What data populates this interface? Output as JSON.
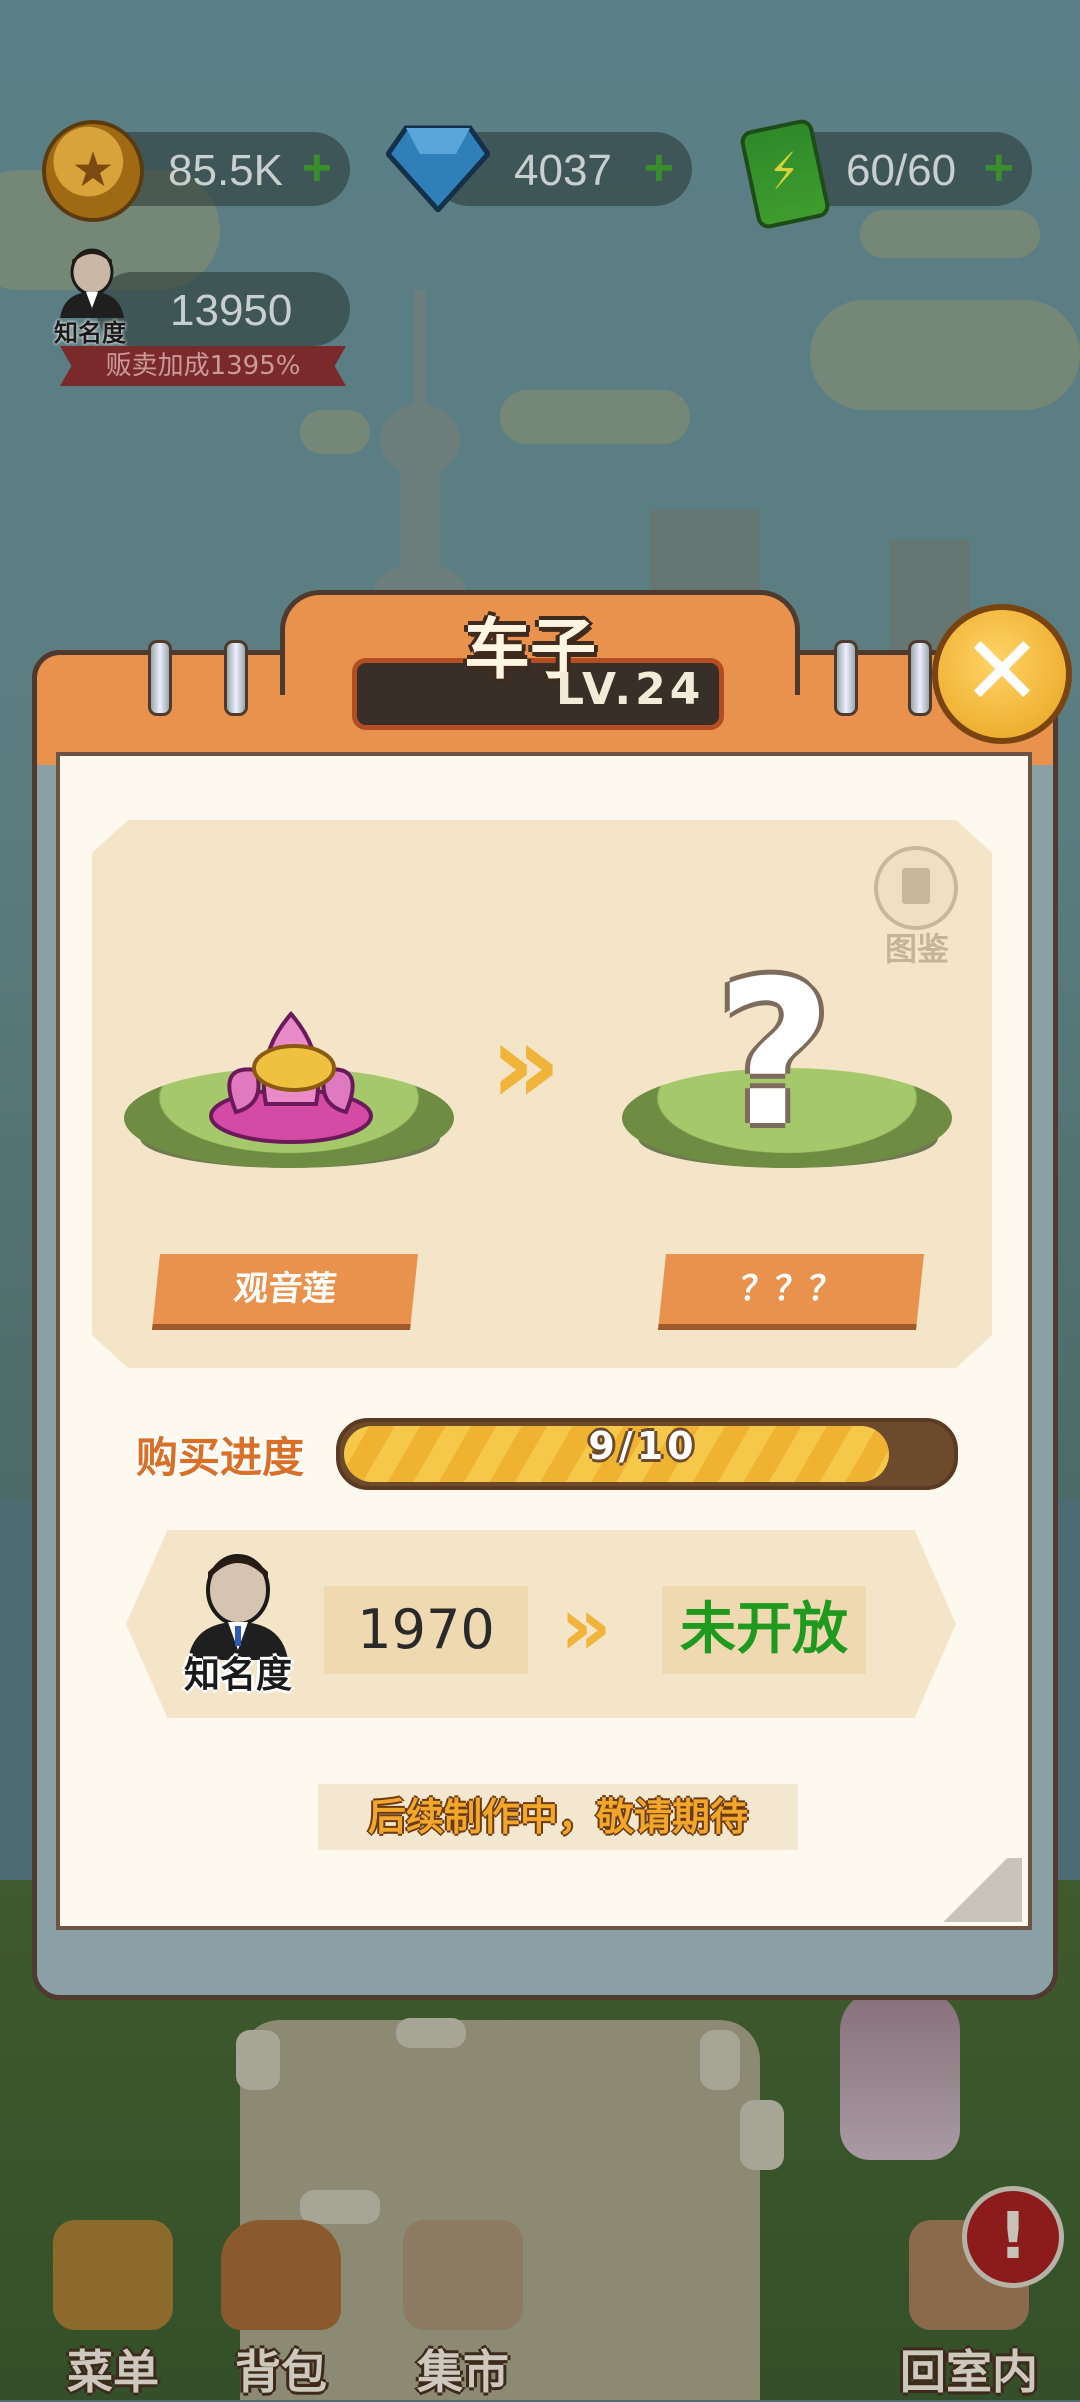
{
  "hud": {
    "coins": "85.5K",
    "gems": "4037",
    "energy": "60/60",
    "fame_value": "13950",
    "fame_label": "知名度",
    "sales_bonus": "贩卖加成1395%",
    "plus": "+"
  },
  "dialog": {
    "title": "车子",
    "level": "LV.24",
    "close": "✕",
    "catalog_label": "图鉴",
    "current_item": "观音莲",
    "next_item": "？？？",
    "question_mark": "?",
    "evolve_arrow": "»",
    "progress_label": "购买进度",
    "progress_text": "9/10",
    "progress_fraction": 0.9,
    "fame_label": "知名度",
    "fame_required": "1970",
    "fame_status": "未开放",
    "coming_soon": "后续制作中，敬请期待"
  },
  "nav": {
    "menu": "菜单",
    "bag": "背包",
    "market": "集市",
    "go_indoor": "回室内",
    "alert": "!"
  },
  "colors": {
    "accent_orange": "#e8924e",
    "paper": "#fdf9ef",
    "panel": "#f4e5c9",
    "status_green": "#1f9a1f",
    "progress_gold": "#f6c84a"
  }
}
